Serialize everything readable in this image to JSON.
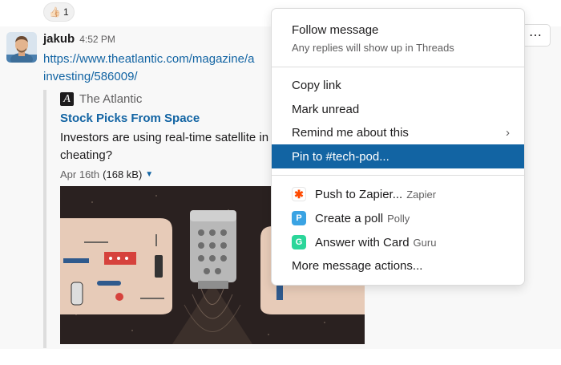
{
  "reaction": {
    "emoji": "👍🏻",
    "count": "1"
  },
  "message": {
    "author": "jakub",
    "time": "4:52 PM",
    "link_line1": "https://www.theatlantic.com/magazine/a",
    "link_line2": "investing/586009/"
  },
  "unfurl": {
    "service_icon": "A",
    "service_name": "The Atlantic",
    "title": "Stock Picks From Space",
    "description_line1": "Investors are using real-time satellite in",
    "description_line2": "cheating?",
    "date": "Apr 16th",
    "size": "(168 kB)"
  },
  "menu": {
    "follow_title": "Follow message",
    "follow_subtitle": "Any replies will show up in Threads",
    "copy_link": "Copy link",
    "mark_unread": "Mark unread",
    "remind": "Remind me about this",
    "pin": "Pin to #tech-pod...",
    "zapier_action": "Push to Zapier...",
    "zapier_app": "Zapier",
    "poll_action": "Create a poll",
    "poll_app": "Polly",
    "card_action": "Answer with Card",
    "card_app": "Guru",
    "more_actions": "More message actions..."
  },
  "colors": {
    "link": "#1264a3",
    "selected": "#1264a3",
    "zapier": "#ff4a00",
    "polly": "#3aa3e3",
    "guru": "#2bd69a"
  },
  "icons": [
    "thumbs-up-emoji",
    "more-actions-icon",
    "chevron-right-icon",
    "caret-down-icon",
    "zapier-icon",
    "polly-icon",
    "guru-icon"
  ]
}
